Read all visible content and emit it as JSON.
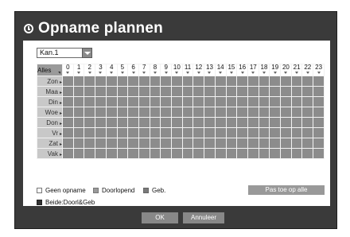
{
  "dialog": {
    "title": "Opname plannen"
  },
  "channel": {
    "selected": "Kan.1"
  },
  "schedule": {
    "all_label": "Alles",
    "hours": [
      "0",
      "1",
      "2",
      "3",
      "4",
      "5",
      "6",
      "7",
      "8",
      "9",
      "10",
      "11",
      "12",
      "13",
      "14",
      "15",
      "16",
      "17",
      "18",
      "19",
      "20",
      "21",
      "22",
      "23"
    ],
    "days": [
      "Zon",
      "Maa",
      "Din",
      "Woe",
      "Don",
      "Vr",
      "Zat",
      "Vak"
    ],
    "day_arrow": "▸"
  },
  "legend": {
    "none": "Geen opname",
    "continuous": "Doorlopend",
    "event": "Geb.",
    "both": "Beide:Doorl&Geb"
  },
  "apply_all_label": "Pas toe op alle",
  "buttons": {
    "ok": "OK",
    "cancel": "Annuleer"
  },
  "colors": {
    "frame": "#3a3a3a",
    "cell_continuous": "#8c8c8c",
    "button": "#888888"
  }
}
